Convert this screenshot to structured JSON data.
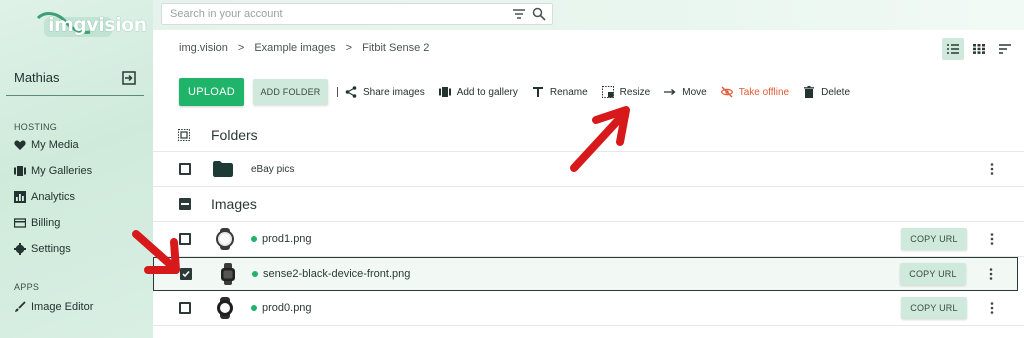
{
  "brand": {
    "logo_text": "imgvision",
    "accent": "#1fb46a",
    "light_accent": "#cfe9dc"
  },
  "sidebar": {
    "user": "Mathias",
    "sections": [
      {
        "label": "HOSTING",
        "items": [
          {
            "label": "My Media",
            "icon": "heart-icon"
          },
          {
            "label": "My Galleries",
            "icon": "gallery-icon"
          },
          {
            "label": "Analytics",
            "icon": "chart-icon"
          },
          {
            "label": "Billing",
            "icon": "card-icon"
          },
          {
            "label": "Settings",
            "icon": "gear-icon"
          }
        ]
      },
      {
        "label": "APPS",
        "items": [
          {
            "label": "Image Editor",
            "icon": "brush-icon"
          }
        ]
      }
    ]
  },
  "search": {
    "placeholder": "Search in your account"
  },
  "breadcrumb": [
    "img.vision",
    "Example images",
    "Fitbit Sense 2"
  ],
  "toolbar": {
    "upload": "UPLOAD",
    "add_folder": "ADD FOLDER",
    "actions": [
      {
        "label": "Share images",
        "icon": "share-icon"
      },
      {
        "label": "Add to gallery",
        "icon": "gallery-icon"
      },
      {
        "label": "Rename",
        "icon": "text-icon"
      },
      {
        "label": "Resize",
        "icon": "resize-icon"
      },
      {
        "label": "Move",
        "icon": "arrow-right-icon"
      },
      {
        "label": "Take offline",
        "icon": "eye-off-icon",
        "color": "#e25a34"
      },
      {
        "label": "Delete",
        "icon": "trash-icon"
      }
    ]
  },
  "folders": {
    "title": "Folders",
    "items": [
      {
        "name": "eBay pics"
      }
    ]
  },
  "images": {
    "title": "Images",
    "copy_label": "COPY URL",
    "items": [
      {
        "name": "prod1.png",
        "status": "online",
        "checked": false
      },
      {
        "name": "sense2-black-device-front.png",
        "status": "online",
        "checked": true
      },
      {
        "name": "prod0.png",
        "status": "online",
        "checked": false
      }
    ]
  },
  "annotations": {
    "arrow_color": "#d7191c"
  }
}
